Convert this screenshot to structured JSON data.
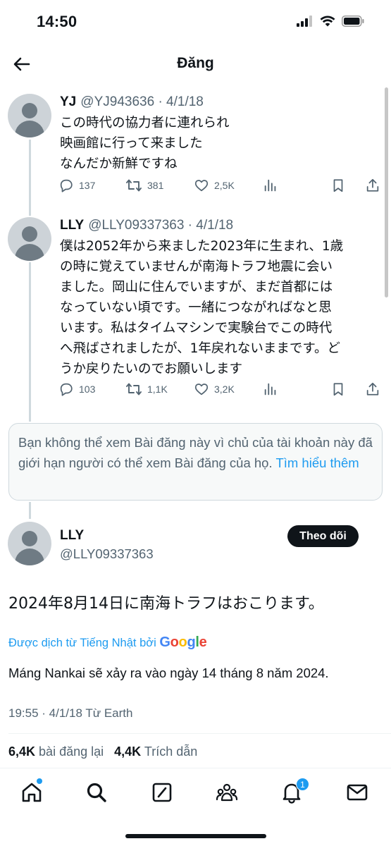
{
  "status_bar": {
    "time": "14:50"
  },
  "header": {
    "title": "Đăng"
  },
  "tweets": [
    {
      "name": "YJ",
      "handle": "@YJ943636 · 4/1/18",
      "lines": [
        "この時代の協力者に連れられ",
        "映画館に行って来ました",
        "なんだか新鮮ですね"
      ],
      "replies": "137",
      "reposts": "381",
      "likes": "2,5K"
    },
    {
      "name": "LLY",
      "handle": "@LLY09337363 · 4/1/18",
      "lines": [
        "僕は2052年から来ました2023年に生まれ、1歳",
        "の時に覚えていませんが南海トラフ地震に会い",
        "ました。岡山に住んでいますが、まだ首都には",
        "なっていない頃です。一緒につながればなと思",
        "います。私はタイムマシンで実験台でこの時代",
        "へ飛ばされましたが、1年戻れないままです。ど",
        "うか戻りたいのでお願いします"
      ],
      "replies": "103",
      "reposts": "1,1K",
      "likes": "3,2K"
    }
  ],
  "notice": {
    "text": "Bạn không thể xem Bài đăng này vì chủ của tài khoản này đã giới hạn người có thể xem Bài đăng của họ.",
    "link": "Tìm hiểu thêm"
  },
  "main_post": {
    "name": "LLY",
    "handle": "@LLY09337363",
    "follow_label": "Theo dõi",
    "text": "2024年8月14日に南海トラフはおこります。",
    "translated_by": "Được dịch từ Tiếng Nhật bởi",
    "translator": "Google",
    "translation": "Máng Nankai sẽ xảy ra vào ngày 14 tháng 8 năm 2024.",
    "timestamp": "19:55 · 4/1/18 Từ Earth",
    "reposts_count": "6,4K",
    "reposts_label": "bài đăng lại",
    "quotes_count": "4,4K",
    "quotes_label": "Trích dẫn"
  },
  "tabbar": {
    "items": [
      "home-icon",
      "search-icon",
      "grok-icon",
      "communities-icon",
      "notifications-icon",
      "messages-icon"
    ],
    "notification_count": "1"
  },
  "colors": {
    "accent": "#1d9bf0",
    "text": "#0f1419",
    "muted": "#536471"
  }
}
